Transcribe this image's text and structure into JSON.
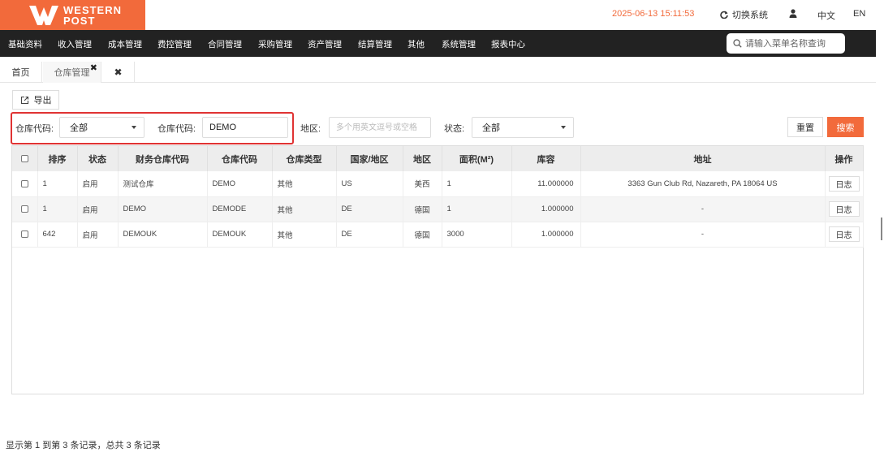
{
  "header": {
    "brand_line1": "WESTERN",
    "brand_line2": "POST",
    "datetime": "2025-06-13 15:11:53",
    "switch_system": "切换系统",
    "lang_zh": "中文",
    "lang_en": "EN",
    "accent_color": "#f26a3b"
  },
  "nav": {
    "items": [
      "基础资料",
      "收入管理",
      "成本管理",
      "费控管理",
      "合同管理",
      "采购管理",
      "资产管理",
      "结算管理",
      "其他",
      "系统管理",
      "报表中心"
    ],
    "search_placeholder": "请输入菜单名称查询"
  },
  "tabs": {
    "home": "首页",
    "warehouse": "仓库管理",
    "close_x": "✖",
    "close_all": "✖"
  },
  "toolbar": {
    "export_label": "导出"
  },
  "filters": {
    "code_select_label": "仓库代码:",
    "code_select_value": "全部",
    "code_input_label": "仓库代码:",
    "code_input_value": "DEMO",
    "region_label": "地区:",
    "region_placeholder": "多个用英文逗号或空格",
    "status_label": "状态:",
    "status_value": "全部",
    "reset_label": "重置",
    "search_label": "搜索"
  },
  "table": {
    "columns": [
      "排序",
      "状态",
      "财务仓库代码",
      "仓库代码",
      "仓库类型",
      "国家/地区",
      "地区",
      "面积(M²)",
      "库容",
      "地址",
      "操作"
    ],
    "rows": [
      {
        "sort": "1",
        "status": "启用",
        "fin_code": "测试仓库",
        "code": "DEMO",
        "type": "其他",
        "country": "US",
        "region": "美西",
        "area": "1",
        "capacity": "11.000000",
        "address": "3363 Gun Club Rd, Nazareth, PA 18064 US",
        "action": "日志"
      },
      {
        "sort": "1",
        "status": "启用",
        "fin_code": "DEMO",
        "code": "DEMODE",
        "type": "其他",
        "country": "DE",
        "region": "德国",
        "area": "1",
        "capacity": "1.000000",
        "address": "-",
        "action": "日志"
      },
      {
        "sort": "642",
        "status": "启用",
        "fin_code": "DEMOUK",
        "code": "DEMOUK",
        "type": "其他",
        "country": "DE",
        "region": "德国",
        "area": "3000",
        "capacity": "1.000000",
        "address": "-",
        "action": "日志"
      }
    ]
  },
  "footer": {
    "summary": "显示第 1 到第 3 条记录，总共 3 条记录"
  }
}
